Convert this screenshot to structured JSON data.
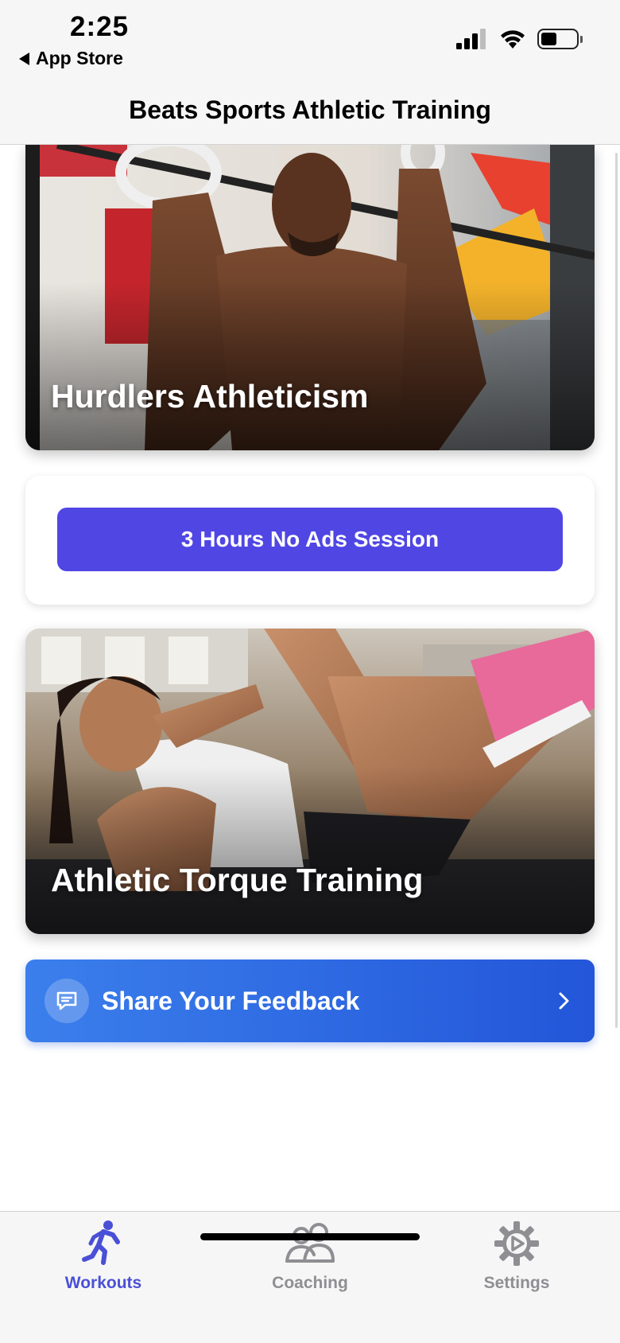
{
  "status_bar": {
    "time": "2:25",
    "back_label": "App Store"
  },
  "header": {
    "title": "Beats Sports Athletic Training"
  },
  "cards": [
    {
      "title": "Hurdlers Athleticism"
    },
    {
      "title": "Athletic Torque Training"
    }
  ],
  "promo": {
    "button_label": "3 Hours No Ads Session"
  },
  "feedback": {
    "label": "Share Your Feedback"
  },
  "tabs": [
    {
      "label": "Workouts",
      "icon": "running-person-icon",
      "active": true
    },
    {
      "label": "Coaching",
      "icon": "people-icon",
      "active": false
    },
    {
      "label": "Settings",
      "icon": "gear-icon",
      "active": false
    }
  ],
  "colors": {
    "accent": "#5046e4",
    "active_tab": "#4a50d6",
    "inactive_tab": "#8e8e93",
    "feedback_start": "#3b7fec",
    "feedback_end": "#2356d9"
  }
}
